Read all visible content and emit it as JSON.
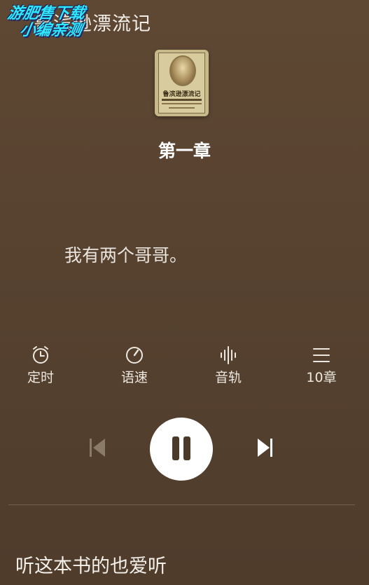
{
  "header": {
    "book_title": "鲁滨逊漂流记",
    "watermark_line1": "游肥售下载",
    "watermark_line2": "小编亲测"
  },
  "cover": {
    "title_text": "鲁滨逊漂流记"
  },
  "chapter": {
    "title": "第一章"
  },
  "lyric": {
    "current_line": "我有两个哥哥。"
  },
  "controls": {
    "timer_label": "定时",
    "speed_label": "语速",
    "track_label": "音轨",
    "chapters_label": "10章"
  },
  "player": {
    "state": "playing"
  },
  "recommend": {
    "title": "听这本书的也爱听"
  },
  "colors": {
    "background": "#574230",
    "accent": "#ffffff",
    "watermark": "#2ee9ff"
  }
}
